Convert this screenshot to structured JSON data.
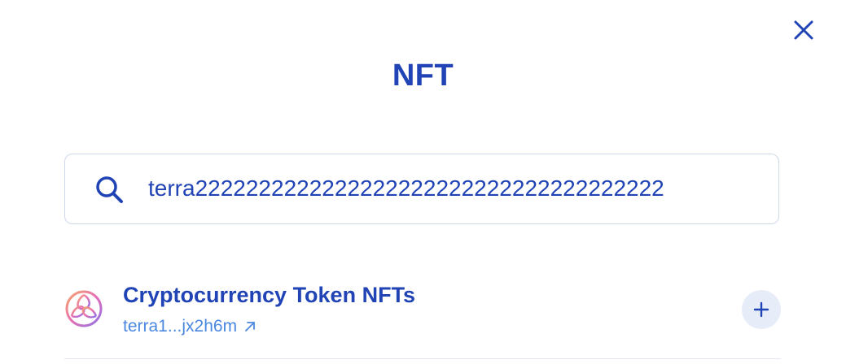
{
  "modal": {
    "title": "NFT"
  },
  "search": {
    "value": "terra2222222222222222222222222222222222222"
  },
  "results": [
    {
      "name": "Cryptocurrency Token NFTs",
      "address": "terra1...jx2h6m"
    }
  ],
  "colors": {
    "primary": "#2043b5",
    "link": "#4b88e0",
    "add_button_bg": "#e6edf8",
    "border": "#cfd8e8"
  },
  "icons": {
    "close": "close-icon",
    "search": "search-icon",
    "external": "external-link-icon",
    "add": "plus-icon",
    "logo": "collection-logo-icon"
  }
}
